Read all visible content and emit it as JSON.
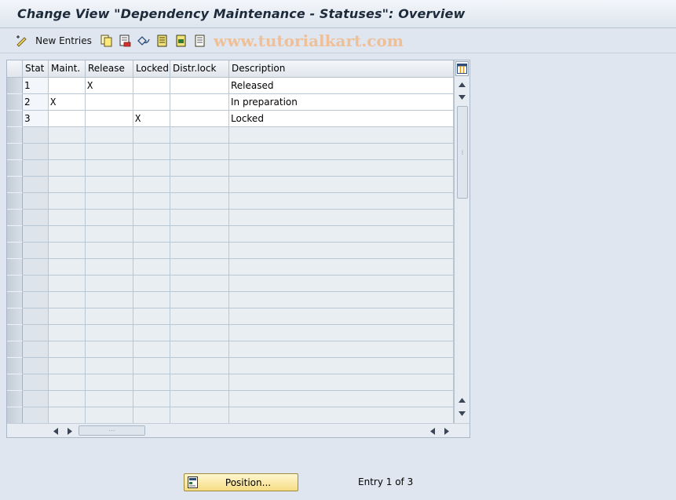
{
  "window": {
    "title": "Change View \"Dependency Maintenance - Statuses\": Overview"
  },
  "toolbar": {
    "new_entries_label": "New Entries",
    "watermark": "www.tutorialkart.com",
    "icons": [
      "edit-pen-icon",
      "copy-icon",
      "delete-icon",
      "undo-icon",
      "select-all-icon",
      "select-block-icon",
      "deselect-all-icon"
    ]
  },
  "table": {
    "columns": [
      "Stat",
      "Maint.",
      "Release",
      "Locked",
      "Distr.lock",
      "Description"
    ],
    "rows": [
      {
        "stat": "1",
        "maint": "",
        "release": "X",
        "locked": "",
        "distr_lock": "",
        "description": "Released"
      },
      {
        "stat": "2",
        "maint": "X",
        "release": "",
        "locked": "",
        "distr_lock": "",
        "description": "In preparation"
      },
      {
        "stat": "3",
        "maint": "",
        "release": "",
        "locked": "X",
        "distr_lock": "",
        "description": "Locked"
      }
    ],
    "visible_row_count": 21
  },
  "footer": {
    "position_button_label": "Position...",
    "entry_status": "Entry 1 of 3"
  },
  "colors": {
    "background": "#dfe6ef",
    "position_button": "#f6dc84",
    "watermark": "#f2b98a"
  }
}
